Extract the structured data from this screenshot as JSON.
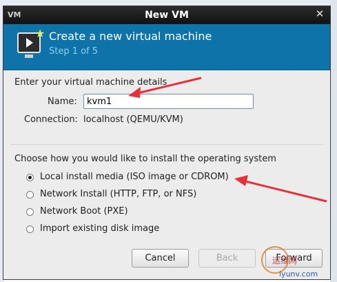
{
  "window": {
    "title": "New VM",
    "app_icon_label": "VM",
    "close_glyph": "✕"
  },
  "header": {
    "title": "Create a new virtual machine",
    "step": "Step 1 of 5",
    "icon": "virtual-machine-monitor-icon"
  },
  "details": {
    "section_label": "Enter your virtual machine details",
    "name_label": "Name:",
    "name_value": "kvm1",
    "connection_label": "Connection:",
    "connection_value": "localhost (QEMU/KVM)"
  },
  "install": {
    "section_label": "Choose how you would like to install the operating system",
    "options": [
      {
        "label": "Local install media (ISO image or CDROM)",
        "selected": true
      },
      {
        "label": "Network Install (HTTP, FTP, or NFS)",
        "selected": false
      },
      {
        "label": "Network Boot (PXE)",
        "selected": false
      },
      {
        "label": "Import existing disk image",
        "selected": false
      }
    ]
  },
  "buttons": {
    "cancel": "Cancel",
    "back": "Back",
    "forward": "Forward",
    "back_enabled": false
  },
  "watermark": {
    "text": "运维网",
    "url": "iyunv.com"
  },
  "colors": {
    "header_bg": "#0d73a8",
    "step_text": "#8fd0f0",
    "annotation_arrow": "#e8303a"
  }
}
